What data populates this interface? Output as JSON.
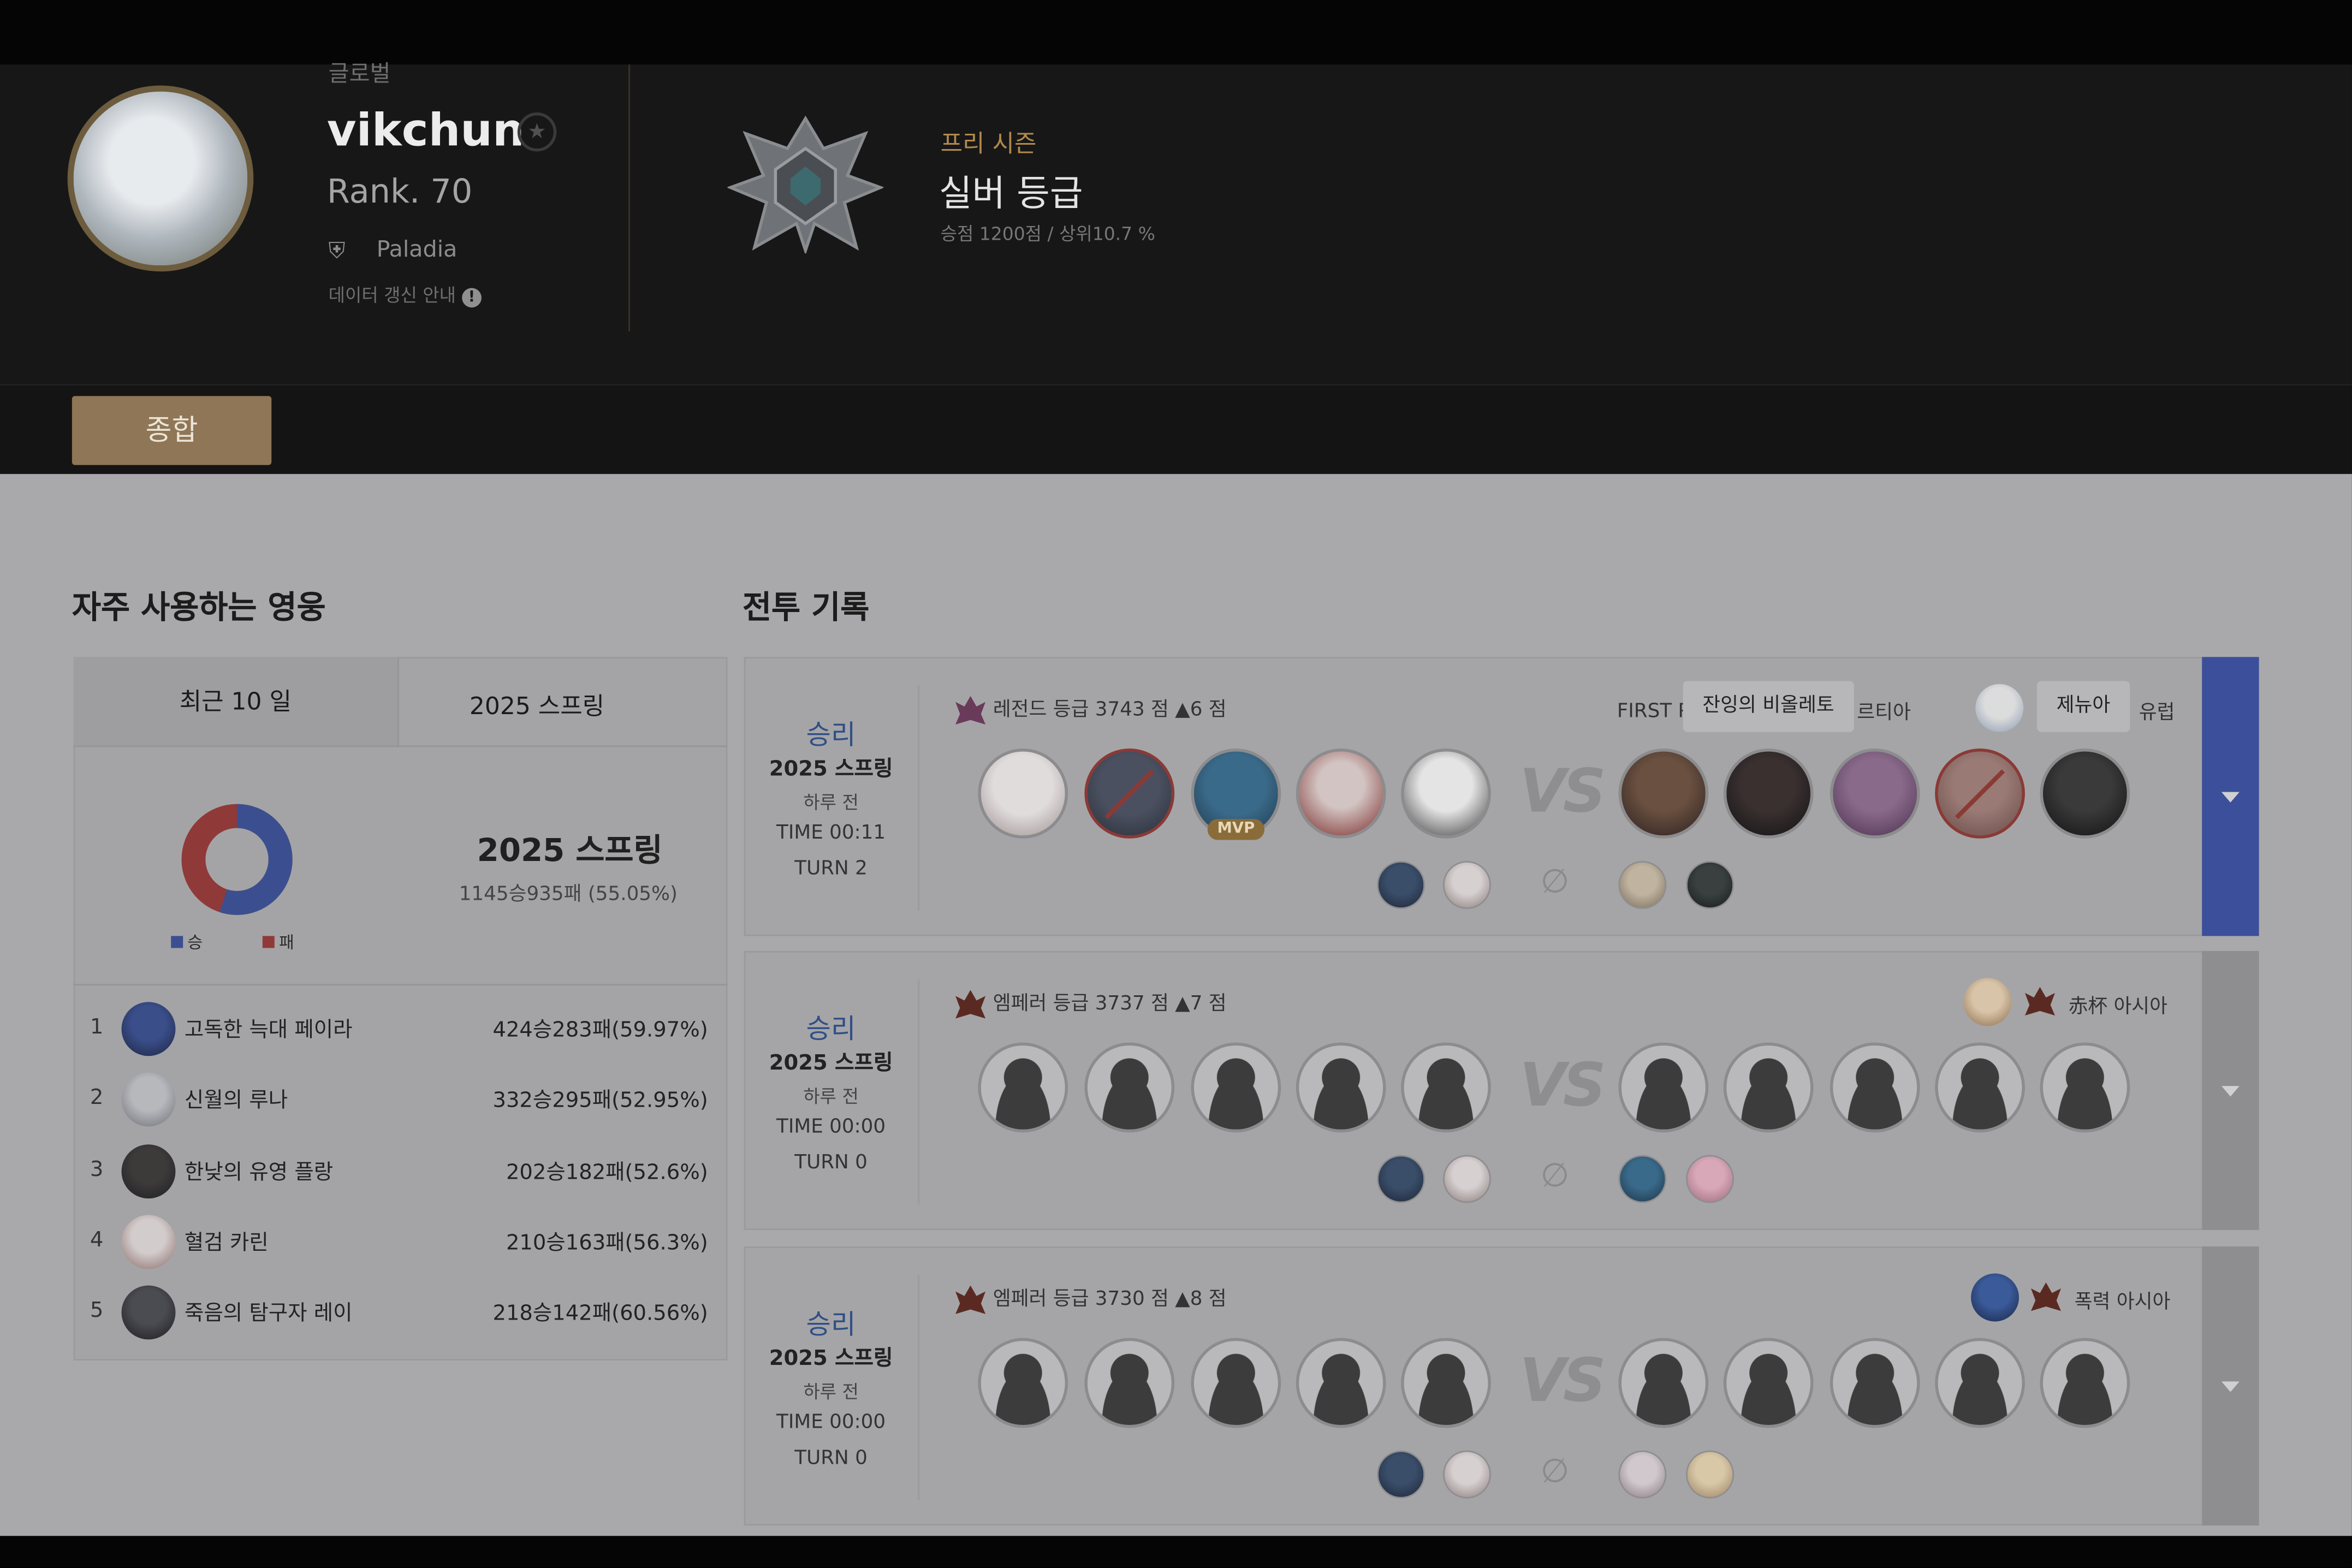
{
  "profile": {
    "region": "글로벌",
    "username": "vikchun",
    "rank": "Rank. 70",
    "guild": "Paladia",
    "data_info": "데이터 갱신 안내",
    "favorite_icon": "star-icon",
    "info_icon": "info-icon"
  },
  "season": {
    "label": "프리 시즌",
    "tier": "실버 등급",
    "stats": "승점 1200점 / 상위10.7 %"
  },
  "tabs": [
    "종합"
  ],
  "sections": {
    "heroes_title": "자주 사용하는 영웅",
    "battle_title": "전투 기록"
  },
  "filters": {
    "recent": "최근 10 일",
    "season": "2025 스프링"
  },
  "summary": {
    "season": "2025 스프링",
    "record": "1145승935패 (55.05%)",
    "win_rate": 55.05,
    "legend_win": "승",
    "legend_loss": "패",
    "colors": {
      "win": "#3b4f90",
      "loss": "#8f3a38"
    }
  },
  "heroes": [
    {
      "rank": "1",
      "name": "고독한 늑대 페이라",
      "record": "424승283패(59.97%)"
    },
    {
      "rank": "2",
      "name": "신월의 루나",
      "record": "332승295패(52.95%)"
    },
    {
      "rank": "3",
      "name": "한낮의 유영 플랑",
      "record": "202승182패(52.6%)"
    },
    {
      "rank": "4",
      "name": "혈검 카린",
      "record": "210승163패(56.3%)"
    },
    {
      "rank": "5",
      "name": "죽음의 탐구자 레이",
      "record": "218승142패(60.56%)"
    }
  ],
  "battles": [
    {
      "result": "승리",
      "season": "2025 스프링",
      "when": "하루 전",
      "time": "TIME 00:11",
      "turn": "TURN 2",
      "tier_line": "레전드 등급 3743 점 ▲6 점",
      "opponent_prefix": "FIRST P",
      "tooltip_1": "잔잉의 비올레토",
      "opponent_partial": "르티아",
      "tooltip_2": "제뉴아",
      "opponent_server": "유럽",
      "mvp": "MVP",
      "vs": "VS",
      "null_symbol": "∅"
    },
    {
      "result": "승리",
      "season": "2025 스프링",
      "when": "하루 전",
      "time": "TIME 00:00",
      "turn": "TURN 0",
      "tier_line": "엠페러 등급 3737 점 ▲7 점",
      "opponent": "赤杯 아시아",
      "vs": "VS",
      "null_symbol": "∅"
    },
    {
      "result": "승리",
      "season": "2025 스프링",
      "when": "하루 전",
      "time": "TIME 00:00",
      "turn": "TURN 0",
      "tier_line": "엠페러 등급 3730 점 ▲8 점",
      "opponent": "폭력 아시아",
      "vs": "VS",
      "null_symbol": "∅"
    }
  ]
}
